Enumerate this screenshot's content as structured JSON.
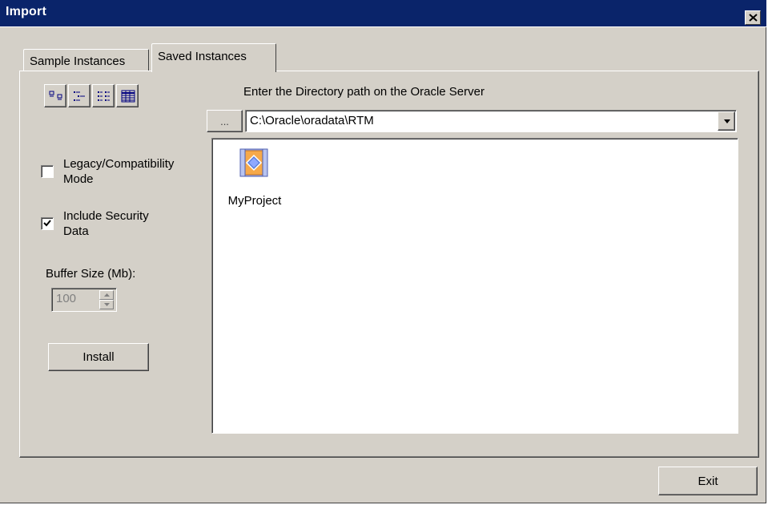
{
  "window": {
    "title": "Import"
  },
  "tabs": [
    {
      "label": "Sample Instances",
      "selected": false
    },
    {
      "label": "Saved Instances",
      "selected": true
    }
  ],
  "view_buttons": [
    "large-icons",
    "small-icons",
    "list",
    "details"
  ],
  "directory": {
    "label": "Enter the Directory path on the Oracle Server",
    "browse_label": "...",
    "path": "C:\\Oracle\\oradata\\RTM"
  },
  "options": {
    "legacy_mode": {
      "label": "Legacy/Compatibility Mode",
      "checked": false
    },
    "include_security": {
      "label": "Include Security Data",
      "checked": true
    }
  },
  "buffer": {
    "label": "Buffer Size (Mb):",
    "value": "100"
  },
  "buttons": {
    "install": "Install",
    "exit": "Exit"
  },
  "items": [
    {
      "label": "MyProject",
      "icon": "project-icon"
    }
  ],
  "colors": {
    "titlebar": "#0a246a",
    "face": "#d4d0c8",
    "icon_orange": "#f6a94a",
    "icon_blue": "#5a7cd8"
  }
}
